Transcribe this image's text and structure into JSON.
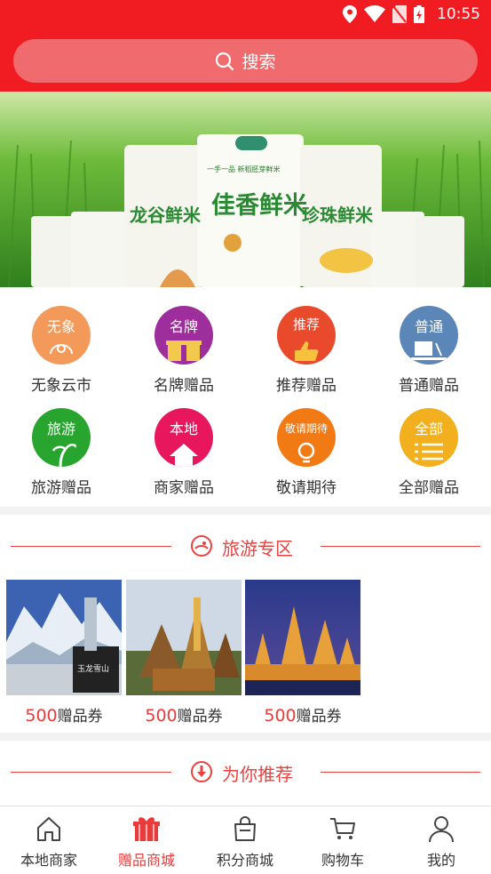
{
  "status_bar": {
    "time": "10:55",
    "icons": [
      "location-icon",
      "wifi-icon",
      "no-sim-icon",
      "battery-charging-icon"
    ]
  },
  "search": {
    "label": "搜索",
    "icon": "search-icon"
  },
  "banner": {
    "brand_small": "一手一品 新稻胚芽鲜米",
    "bags": [
      "龙谷鲜米",
      "佳香鲜米",
      "珍珠鲜米"
    ]
  },
  "categories": [
    {
      "badge": "无象",
      "label": "无象云市",
      "color": "#f39a5a"
    },
    {
      "badge": "名牌",
      "label": "名牌赠品",
      "color": "#9d2e9c"
    },
    {
      "badge": "推荐",
      "label": "推荐赠品",
      "color": "#e94a2c"
    },
    {
      "badge": "普通",
      "label": "普通赠品",
      "color": "#5b86b8"
    },
    {
      "badge": "旅游",
      "label": "旅游赠品",
      "color": "#27a52e"
    },
    {
      "badge": "本地",
      "label": "商家赠品",
      "color": "#e8175d"
    },
    {
      "badge": "敬请期待",
      "label": "敬请期待",
      "color": "#f27a14"
    },
    {
      "badge": "全部",
      "label": "全部赠品",
      "color": "#f2b01e"
    }
  ],
  "travel": {
    "title": "旅游专区",
    "cards": [
      {
        "amount": "500",
        "unit": "赠品券",
        "sign": "玉龙雪山"
      },
      {
        "amount": "500",
        "unit": "赠品券"
      },
      {
        "amount": "500",
        "unit": "赠品券"
      }
    ]
  },
  "recommend": {
    "title": "为你推荐"
  },
  "bottom_nav": [
    {
      "label": "本地商家",
      "icon": "home-icon",
      "active": false
    },
    {
      "label": "赠品商城",
      "icon": "gift-icon",
      "active": true
    },
    {
      "label": "积分商城",
      "icon": "shopping-bag-icon",
      "active": false
    },
    {
      "label": "购物车",
      "icon": "cart-icon",
      "active": false
    },
    {
      "label": "我的",
      "icon": "user-icon",
      "active": false
    }
  ],
  "colors": {
    "primary": "#f01c22",
    "accent_text": "#e9413e",
    "search_bg": "#f06b6e"
  }
}
